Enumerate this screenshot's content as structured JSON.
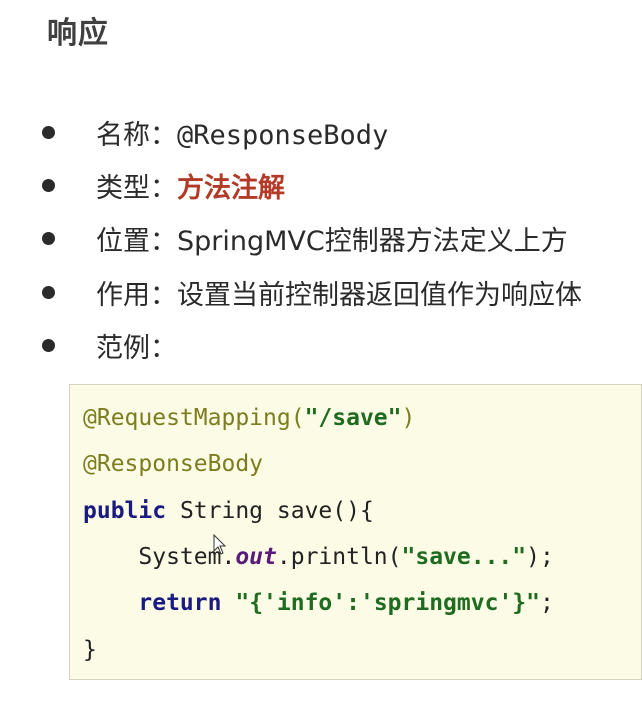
{
  "title": "响应",
  "items": [
    {
      "label": "名称：",
      "value": "@ResponseBody"
    },
    {
      "label": "类型：",
      "value": "方法注解"
    },
    {
      "label": "位置：",
      "value": "SpringMVC控制器方法定义上方"
    },
    {
      "label": "作用：",
      "value": "设置当前控制器返回值作为响应体"
    },
    {
      "label": "范例：",
      "value": ""
    }
  ],
  "code": {
    "line1_annotation": "@RequestMapping(",
    "line1_string": "\"/save\"",
    "line1_close": ")",
    "line2_annotation": "@ResponseBody",
    "line3_keyword": "public",
    "line3_rest": " String save(){",
    "line4_prefix": "    System.",
    "line4_field": "out",
    "line4_mid": ".println(",
    "line4_string": "\"save...\"",
    "line4_end": ");",
    "line5_indent": "    ",
    "line5_keyword": "return",
    "line5_space": " ",
    "line5_string": "\"{'info':'springmvc'}\"",
    "line5_end": ";",
    "line6": "}"
  },
  "colors": {
    "accent": "#b33a26",
    "annotation": "#7d7d1f",
    "string": "#1f6b1f",
    "keyword": "#1a1a80",
    "code_bg": "#fbfbe6"
  },
  "icons": [
    "bullet-dot",
    "mouse-cursor-icon"
  ]
}
